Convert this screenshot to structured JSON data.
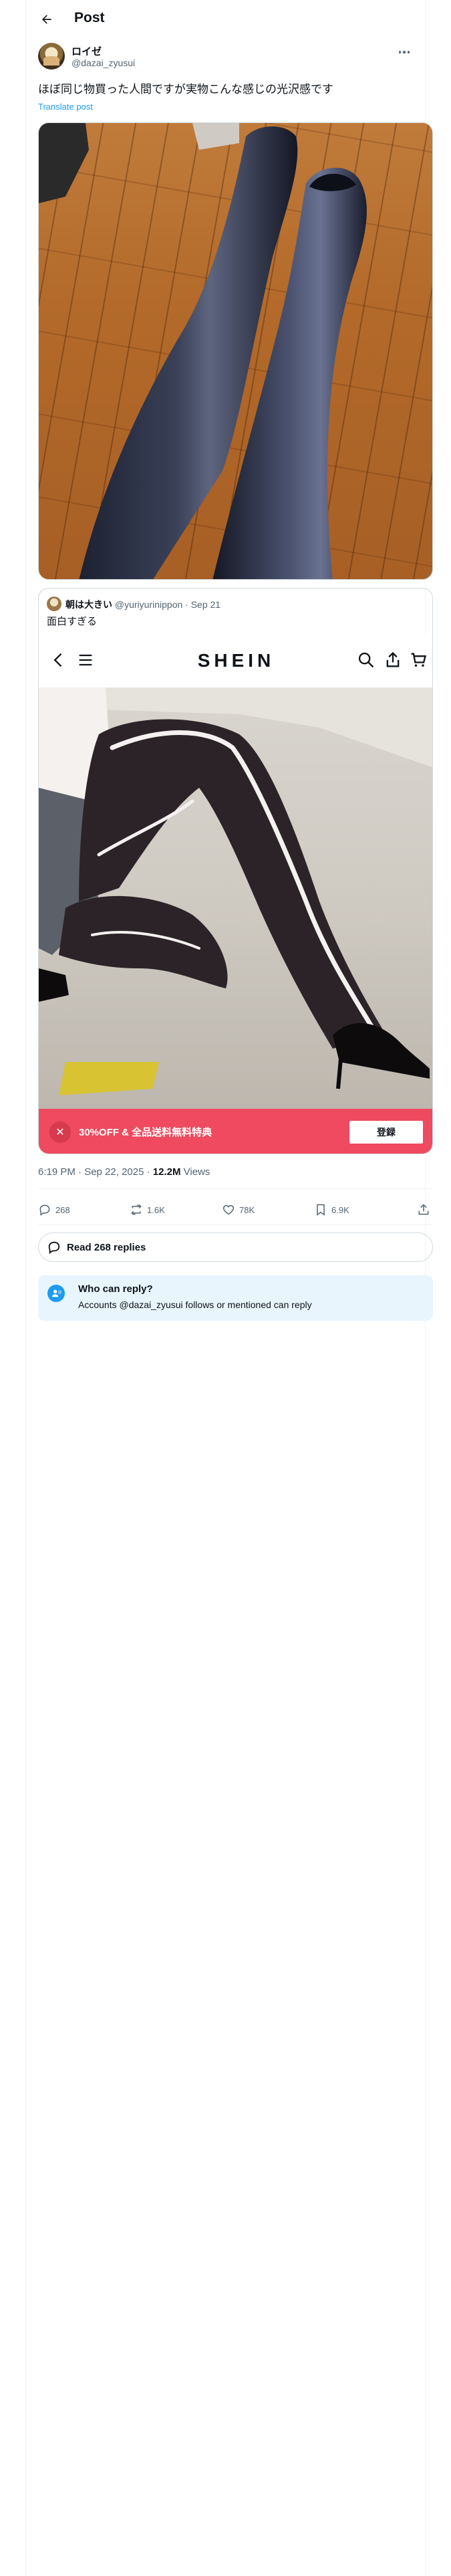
{
  "header": {
    "title": "Post"
  },
  "author": {
    "display_name": "ロイゼ",
    "handle": "@dazai_zyusui"
  },
  "post": {
    "text": "ほぼ同じ物買った人間ですが実物こんな感じの光沢感です",
    "translate_label": "Translate post"
  },
  "quoted": {
    "display_name": "朝は大きい",
    "handle": "@yuriyurinippon",
    "date": "Sep 21",
    "text": "面白すぎる",
    "app": {
      "brand": "SHEIN",
      "promo_text": "30%OFF & 全品送料無料特典",
      "promo_button": "登録",
      "close_glyph": "✕"
    }
  },
  "meta": {
    "time_date": "6:19 PM · Sep 22, 2025 · ",
    "views_count": "12.2M",
    "views_label": " Views"
  },
  "actions": {
    "replies": "268",
    "reposts": "1.6K",
    "likes": "78K",
    "bookmarks": "6.9K"
  },
  "read_replies": {
    "label": "Read 268 replies"
  },
  "reply_restriction": {
    "title": "Who can reply?",
    "description": "Accounts @dazai_zyusui follows or mentioned can reply"
  },
  "colors": {
    "accent": "#1d9bf0",
    "promo": "#ef4a5f",
    "muted": "#536471"
  }
}
